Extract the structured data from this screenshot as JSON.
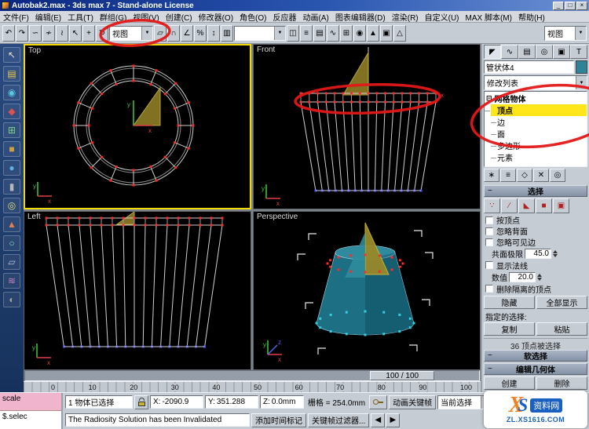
{
  "colors": {
    "annotation": "#e31717",
    "active_viewport_border": "#f4d800",
    "vertex_red": "#ff2a2a",
    "vertex_blue": "#4848ff",
    "vertex_cyan": "#35d0e0",
    "cone_teal": "#1d6f83",
    "wire": "#cfcfcf",
    "highlight_yellow": "#ffe61a"
  },
  "window": {
    "title": "Autobak2.max - 3ds max 7 - Stand-alone License",
    "controls": [
      {
        "name": "minimize-button",
        "glyph": "_"
      },
      {
        "name": "maximize-button",
        "glyph": "□"
      },
      {
        "name": "close-button",
        "glyph": "×"
      }
    ]
  },
  "menu": {
    "items": [
      "文件(F)",
      "编辑(E)",
      "工具(T)",
      "群组(G)",
      "视图(V)",
      "创建(C)",
      "修改器(O)",
      "角色(O)",
      "反应器",
      "动画(A)",
      "图表编辑器(D)",
      "渲染(R)",
      "自定义(U)",
      "MAX 脚本(M)",
      "帮助(H)"
    ]
  },
  "icons": {
    "dropdown": "▼",
    "tree_collapse": "⊟"
  },
  "toolbar": {
    "coord_system_value": "视图",
    "right_combo_value": "视图",
    "left_icons": [
      {
        "name": "undo-icon",
        "glyph": "↶"
      },
      {
        "name": "redo-icon",
        "glyph": "↷"
      },
      {
        "name": "select-link-icon",
        "glyph": "∽"
      },
      {
        "name": "unlink-icon",
        "glyph": "≁"
      },
      {
        "name": "bind-spacewarp-icon",
        "glyph": "≀"
      },
      {
        "name": "select-object-icon",
        "glyph": "↖"
      },
      {
        "name": "select-move-icon",
        "glyph": "+"
      },
      {
        "name": "select-rotate-icon",
        "glyph": "↻"
      }
    ],
    "mid_icons": [
      {
        "name": "select-scale-icon",
        "glyph": "▱"
      },
      {
        "name": "snap-toggle-icon",
        "glyph": "∩"
      },
      {
        "name": "angle-snap-icon",
        "glyph": "∠"
      },
      {
        "name": "percent-snap-icon",
        "glyph": "%"
      },
      {
        "name": "spinner-snap-icon",
        "glyph": "↕"
      },
      {
        "name": "edit-named-selections-icon",
        "glyph": "▥"
      }
    ],
    "right_icons": [
      {
        "name": "mirror-icon",
        "glyph": "◫"
      },
      {
        "name": "align-icon",
        "glyph": "≡"
      },
      {
        "name": "layer-manager-icon",
        "glyph": "▤"
      },
      {
        "name": "curve-editor-icon",
        "glyph": "∿"
      },
      {
        "name": "schematic-view-icon",
        "glyph": "⊞"
      },
      {
        "name": "material-editor-icon",
        "glyph": "◉"
      },
      {
        "name": "render-scene-icon",
        "glyph": "▲"
      },
      {
        "name": "render-type-icon",
        "glyph": "▣"
      },
      {
        "name": "quick-render-icon",
        "glyph": "△"
      }
    ]
  },
  "left_toolbar": {
    "icons": [
      {
        "name": "left-tool-select",
        "glyph": "↖",
        "color": "#e8e0c0"
      },
      {
        "name": "left-tool-layers",
        "glyph": "▤",
        "color": "#e8c850"
      },
      {
        "name": "left-tool-circle",
        "glyph": "◉",
        "color": "#58c8e0"
      },
      {
        "name": "left-tool-diamond",
        "glyph": "◆",
        "color": "#e05050"
      },
      {
        "name": "left-tool-grid",
        "glyph": "⊞",
        "color": "#80d080"
      },
      {
        "name": "left-tool-box",
        "glyph": "■",
        "color": "#d0a040"
      },
      {
        "name": "left-tool-sphere",
        "glyph": "●",
        "color": "#60b0e0"
      },
      {
        "name": "left-tool-cylinder",
        "glyph": "▮",
        "color": "#b8b8b8"
      },
      {
        "name": "left-tool-tube",
        "glyph": "◎",
        "color": "#e0e080"
      },
      {
        "name": "left-tool-cone",
        "glyph": "▲",
        "color": "#e08050"
      },
      {
        "name": "left-tool-torus",
        "glyph": "○",
        "color": "#90e0d0"
      },
      {
        "name": "left-tool-plane",
        "glyph": "▱",
        "color": "#c0c0e0"
      },
      {
        "name": "left-tool-wave",
        "glyph": "≋",
        "color": "#d080c0"
      },
      {
        "name": "left-tool-half",
        "glyph": "◐",
        "color": "#a0a0a0"
      }
    ]
  },
  "viewports": {
    "top_label": "Top",
    "front_label": "Front",
    "left_label": "Left",
    "perspective_label": "Perspective",
    "axis": {
      "x": "x",
      "y": "y",
      "z": "z"
    }
  },
  "time": {
    "slider_label": "100 / 100",
    "ruler": [
      "0",
      "10",
      "20",
      "30",
      "40",
      "50",
      "60",
      "70",
      "80",
      "90",
      "100"
    ]
  },
  "command_panel": {
    "tabs": [
      {
        "name": "create-tab",
        "glyph": "◤"
      },
      {
        "name": "modify-tab",
        "glyph": "∿"
      },
      {
        "name": "hierarchy-tab",
        "glyph": "▤"
      },
      {
        "name": "motion-tab",
        "glyph": "◎"
      },
      {
        "name": "display-tab",
        "glyph": "▣"
      },
      {
        "name": "utilities-tab",
        "glyph": "T"
      }
    ],
    "object_name": "管状体4",
    "modifier_list_label": "修改列表",
    "stack": {
      "root": "网格物体",
      "children": [
        "顶点",
        "边",
        "面",
        "多边形",
        "元素"
      ]
    },
    "stack_buttons": [
      {
        "name": "pin-stack-icon",
        "glyph": "∗"
      },
      {
        "name": "show-end-result-icon",
        "glyph": "≡"
      },
      {
        "name": "make-unique-icon",
        "glyph": "◇"
      },
      {
        "name": "remove-modifier-icon",
        "glyph": "✕"
      },
      {
        "name": "configure-stack-icon",
        "glyph": "◎"
      }
    ],
    "rollout_selection": "选择",
    "subobject_icons": [
      {
        "name": "vertex-mode-icon",
        "glyph": "∵"
      },
      {
        "name": "edge-mode-icon",
        "glyph": "∕"
      },
      {
        "name": "face-mode-icon",
        "glyph": "◣"
      },
      {
        "name": "polygon-mode-icon",
        "glyph": "■"
      },
      {
        "name": "element-mode-icon",
        "glyph": "▣"
      }
    ],
    "opt_by_vertex": "按顶点",
    "opt_ignore_backfacing": "忽略背面",
    "opt_ignore_visible": "忽略可见边",
    "planar_label": "共面极限",
    "planar_value": "45.0",
    "opt_show_normals": "显示法线",
    "scale_label": "数值",
    "scale_value": "20.0",
    "opt_delete_isolated": "删除隔离的顶点",
    "btn_hide": "隐藏",
    "btn_unhide": "全部显示",
    "named_sel_label": "指定的选择:",
    "btn_copy": "复制",
    "btn_paste": "粘贴",
    "sel_status": "36 顶点被选择",
    "rollout_soft": "软选择",
    "rollout_editgeo": "编辑几何体",
    "btn_create": "创建",
    "btn_delete": "删除"
  },
  "statusbar": {
    "listener_macro": "scale",
    "listener_script": "$.selec",
    "selection_status": "1 物体已选择",
    "coords": [
      {
        "axis": "X:",
        "value": "-2090.9"
      },
      {
        "axis": "Y:",
        "value": "351.288"
      },
      {
        "axis": "Z:",
        "value": "0.0mm"
      }
    ],
    "grid_label": "栅格 = 254.0mm",
    "prompt": "The Radiosity Solution has been Invalidated",
    "add_time_tag": "添加时间标记",
    "btn_auto_key": "动画关键帧",
    "sel_filter_value": "当前选择",
    "btn_key_filters": "关键帧过滤器...",
    "playback": [
      {
        "name": "go-to-start-button",
        "glyph": "|◀"
      },
      {
        "name": "previous-frame-button",
        "glyph": "◀"
      },
      {
        "name": "play-animation-button",
        "glyph": "▶"
      },
      {
        "name": "go-to-end-button",
        "glyph": "▶|"
      }
    ],
    "key_steps": [
      {
        "name": "previous-key-button",
        "glyph": "◀"
      },
      {
        "name": "next-key-button",
        "glyph": "▶"
      }
    ],
    "nav_icons": [
      {
        "name": "zoom-icon",
        "glyph": "⊕"
      },
      {
        "name": "zoom-all-icon",
        "glyph": "⊞"
      },
      {
        "name": "zoom-extents-icon",
        "glyph": "⊡"
      },
      {
        "name": "zoom-region-icon",
        "glyph": "▭"
      },
      {
        "name": "pan-icon",
        "glyph": "+"
      },
      {
        "name": "arc-rotate-icon",
        "glyph": "↻"
      },
      {
        "name": "maximize-viewport-icon",
        "glyph": "▣"
      },
      {
        "name": "field-of-view-icon",
        "glyph": "□"
      }
    ]
  },
  "watermark": {
    "x": "X",
    "s": "S",
    "site_name": "资料网",
    "url": "ZL.XS1616.COM"
  }
}
